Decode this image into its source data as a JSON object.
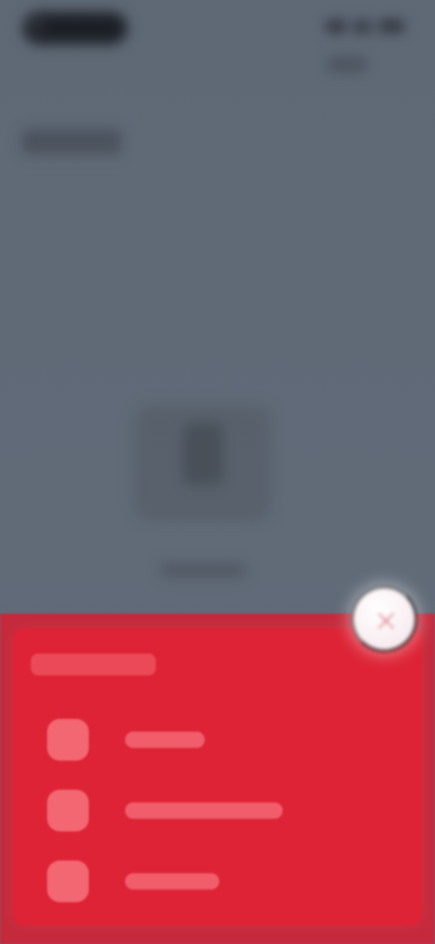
{
  "screen": {
    "title": "",
    "status_time": "",
    "sheet_title": "",
    "menu_items": [
      {
        "label": ""
      },
      {
        "label": ""
      },
      {
        "label": ""
      }
    ],
    "center_label": ""
  },
  "icons": {
    "status_signal": "signal-icon",
    "status_wifi": "wifi-icon",
    "status_battery": "battery-icon",
    "center_card": "device-icon",
    "menu_1": "menu-option-icon",
    "menu_2": "menu-option-icon",
    "menu_3": "menu-option-icon",
    "fab": "close-icon"
  },
  "colors": {
    "background": "#5d6774",
    "sheet": "#dd2335",
    "sheet_edge": "#c52a3c",
    "fab": "#ffffff"
  }
}
